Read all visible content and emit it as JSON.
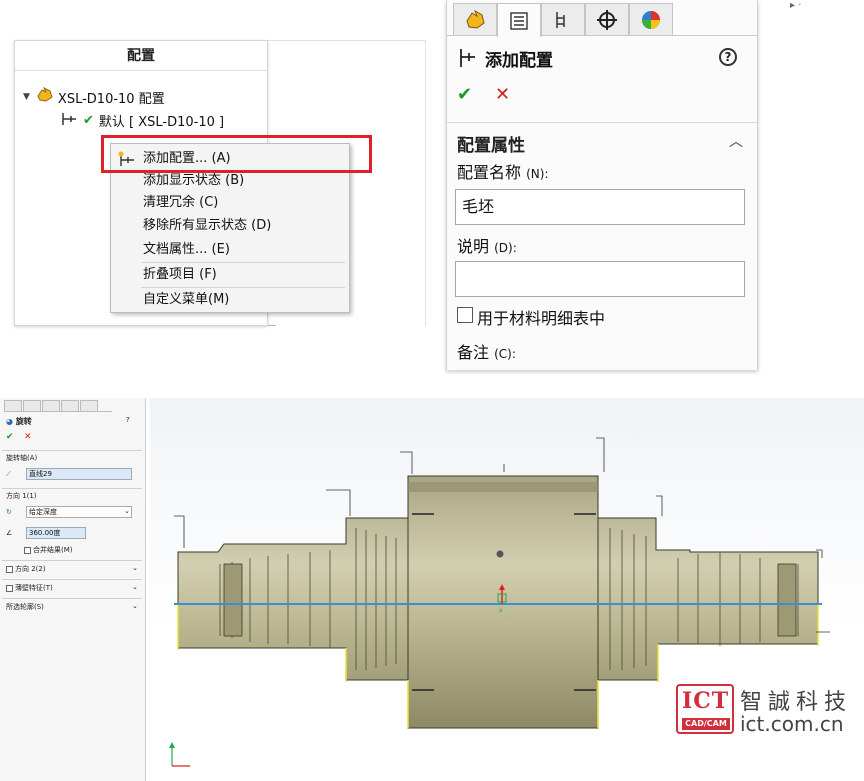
{
  "config_manager": {
    "title": "配置",
    "tree": {
      "root_label": "XSL-D10-10 配置",
      "child_label": "默认 [ XSL-D10-10 ]"
    },
    "context_menu": {
      "items": [
        "添加配置... (A)",
        "添加显示状态 (B)",
        "清理冗余 (C)",
        "移除所有显示状态 (D)",
        "文档属性... (E)",
        "折叠项目 (F)",
        "自定义菜单(M)"
      ]
    }
  },
  "property_manager": {
    "title": "添加配置",
    "help": "?",
    "ok": "✔",
    "cancel": "✕",
    "section_title": "配置属性",
    "config_name_label": "配置名称",
    "config_name_hint": "(N):",
    "config_name_value": "毛坯",
    "description_label": "说明",
    "description_hint": "(D):",
    "description_value": "",
    "bom_label": "用于材料明细表中",
    "notes_label": "备注",
    "notes_hint": "(C):"
  },
  "cad": {
    "feature_title": "旋转",
    "ok": "✔",
    "cancel": "✕",
    "help": "?",
    "axis_section": "旋转轴(A)",
    "axis_value": "直线29",
    "dir1_section": "方向 1(1)",
    "dir1_type": "给定深度",
    "angle_value": "360.00度",
    "merge_label": "合并结果(M)",
    "dir2_section": "方向 2(2)",
    "thin_section": "薄壁特征(T)",
    "contours_section": "所选轮廓(S)"
  },
  "watermark": {
    "logo_text": "ICT",
    "logo_sub": "CAD/CAM",
    "company": "智誠科技",
    "url": "ict.com.cn"
  },
  "colors": {
    "highlight_red": "#e0202a",
    "ok_green": "#1a9a2a",
    "cancel_red": "#d21e1e",
    "part_body": "#c9c5a4",
    "axis_blue": "#3a8fd6",
    "watermark_red": "#d12f3c"
  }
}
